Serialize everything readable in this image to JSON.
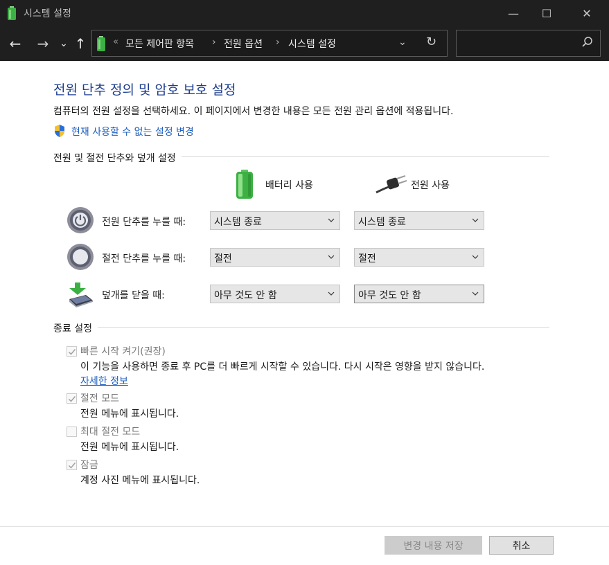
{
  "window": {
    "title": "시스템 설정",
    "minimize_glyph": "—",
    "maximize_glyph": "☐",
    "close_glyph": "✕"
  },
  "nav": {
    "back_glyph": "←",
    "forward_glyph": "→",
    "recent_glyph": "⌄",
    "up_glyph": "↑",
    "breadcrumb_prefix": "«",
    "breadcrumbs": [
      "모든 제어판 항목",
      "전원 옵션",
      "시스템 설정"
    ],
    "breadcrumb_separator": "›",
    "dropdown_glyph": "⌄",
    "refresh_glyph": "↻",
    "search_placeholder": ""
  },
  "content": {
    "heading": "전원 단추 정의 및 암호 보호 설정",
    "description": "컴퓨터의 전원 설정을 선택하세요. 이 페이지에서 변경한 내용은 모든 전원 관리 옵션에 적용됩니다.",
    "change_link": "현재 사용할 수 없는 설정 변경"
  },
  "buttons_section": {
    "title": "전원 및 절전 단추와 덮개 설정",
    "column_battery": "배터리 사용",
    "column_plugged": "전원 사용",
    "rows": [
      {
        "label": "전원 단추를 누를 때:",
        "icon": "power-button-icon",
        "battery": "시스템 종료",
        "plugged": "시스템 종료"
      },
      {
        "label": "절전 단추를 누를 때:",
        "icon": "sleep-button-icon",
        "battery": "절전",
        "plugged": "절전"
      },
      {
        "label": "덮개를 닫을 때:",
        "icon": "laptop-lid-icon",
        "battery": "아무 것도 안 함",
        "plugged": "아무 것도 안 함"
      }
    ]
  },
  "shutdown_section": {
    "title": "종료 설정",
    "items": [
      {
        "label": "빠른 시작 켜기(권장)",
        "checked": true,
        "description": "이 기능을 사용하면 종료 후 PC를 더 빠르게 시작할 수 있습니다. 다시 시작은 영향을 받지 않습니다.",
        "link": "자세한 정보"
      },
      {
        "label": "절전 모드",
        "checked": true,
        "description": "전원 메뉴에 표시됩니다."
      },
      {
        "label": "최대 절전 모드",
        "checked": false,
        "description": "전원 메뉴에 표시됩니다."
      },
      {
        "label": "잠금",
        "checked": true,
        "description": "계정 사진 메뉴에 표시됩니다."
      }
    ]
  },
  "footer": {
    "save_label": "변경 내용 저장",
    "cancel_label": "취소"
  },
  "colors": {
    "heading": "#1e3d8f",
    "link": "#1f5fbf",
    "titlebar": "#1f1f1f",
    "battery_green": "#3cb043"
  }
}
